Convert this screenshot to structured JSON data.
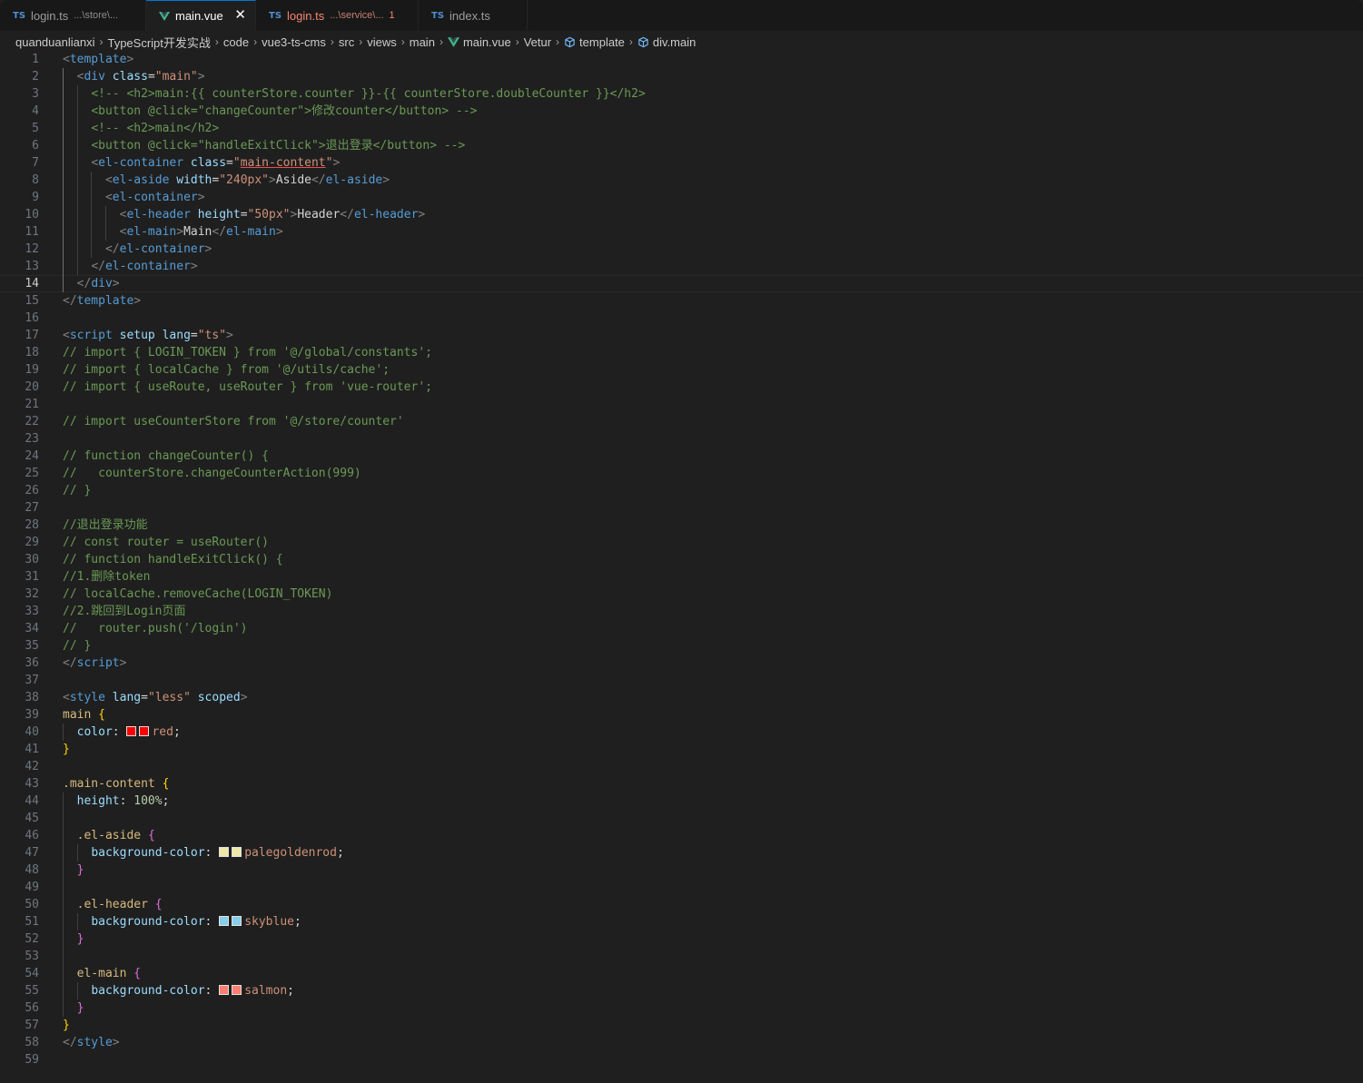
{
  "tabs": [
    {
      "lang": "TS",
      "name": "login.ts",
      "desc": "...\\store\\...",
      "active": false,
      "error": false
    },
    {
      "lang": "V",
      "name": "main.vue",
      "desc": "",
      "active": true,
      "error": false,
      "close": "✕"
    },
    {
      "lang": "TS",
      "name": "login.ts",
      "desc": "...\\service\\...",
      "active": false,
      "error": true,
      "badge": "1"
    },
    {
      "lang": "TS",
      "name": "index.ts",
      "desc": "",
      "active": false,
      "error": false
    }
  ],
  "breadcrumb": [
    "quanduanlianxi",
    "TypeScript开发实战",
    "code",
    "vue3-ts-cms",
    "src",
    "views",
    "main",
    "main.vue",
    "Vetur",
    "template",
    "div.main"
  ],
  "current_line": 14,
  "colors": {
    "accent": "#0078d4",
    "error": "#f48771",
    "swatch_red": "#ff0000",
    "swatch_palegoldenrod": "#eee8aa",
    "swatch_skyblue": "#87ceeb",
    "swatch_salmon": "#fa8072"
  },
  "lines": [
    [
      [
        "k-punct",
        "<"
      ],
      [
        "k-tag",
        "template"
      ],
      [
        "k-punct",
        ">"
      ]
    ],
    [
      [
        "",
        "  "
      ],
      [
        "k-punct",
        "<"
      ],
      [
        "k-tag",
        "div"
      ],
      [
        "k-text",
        " "
      ],
      [
        "k-attr",
        "class"
      ],
      [
        "k-text",
        "="
      ],
      [
        "k-str",
        "\"main\""
      ],
      [
        "k-punct",
        ">"
      ]
    ],
    [
      [
        "",
        "    "
      ],
      [
        "k-com",
        "<!-- <h2>main:{{ counterStore.counter }}-{{ counterStore.doubleCounter }}</h2>"
      ]
    ],
    [
      [
        "",
        "    "
      ],
      [
        "k-com",
        "<button @click=\"changeCounter\">修改counter</button> -->"
      ]
    ],
    [
      [
        "",
        "    "
      ],
      [
        "k-com",
        "<!-- <h2>main</h2>"
      ]
    ],
    [
      [
        "",
        "    "
      ],
      [
        "k-com",
        "<button @click=\"handleExitClick\">退出登录</button> -->"
      ]
    ],
    [
      [
        "",
        "    "
      ],
      [
        "k-punct",
        "<"
      ],
      [
        "k-tag",
        "el-container"
      ],
      [
        "k-text",
        " "
      ],
      [
        "k-attr",
        "class"
      ],
      [
        "k-text",
        "="
      ],
      [
        "k-str",
        "\""
      ],
      [
        "k-str k-und",
        "main-content"
      ],
      [
        "k-str",
        "\""
      ],
      [
        "k-punct",
        ">"
      ]
    ],
    [
      [
        "",
        "      "
      ],
      [
        "k-punct",
        "<"
      ],
      [
        "k-tag",
        "el-aside"
      ],
      [
        "k-text",
        " "
      ],
      [
        "k-attr",
        "width"
      ],
      [
        "k-text",
        "="
      ],
      [
        "k-str",
        "\"240px\""
      ],
      [
        "k-punct",
        ">"
      ],
      [
        "k-text",
        "Aside"
      ],
      [
        "k-punct",
        "</"
      ],
      [
        "k-tag",
        "el-aside"
      ],
      [
        "k-punct",
        ">"
      ]
    ],
    [
      [
        "",
        "      "
      ],
      [
        "k-punct",
        "<"
      ],
      [
        "k-tag",
        "el-container"
      ],
      [
        "k-punct",
        ">"
      ]
    ],
    [
      [
        "",
        "        "
      ],
      [
        "k-punct",
        "<"
      ],
      [
        "k-tag",
        "el-header"
      ],
      [
        "k-text",
        " "
      ],
      [
        "k-attr",
        "height"
      ],
      [
        "k-text",
        "="
      ],
      [
        "k-str",
        "\"50px\""
      ],
      [
        "k-punct",
        ">"
      ],
      [
        "k-text",
        "Header"
      ],
      [
        "k-punct",
        "</"
      ],
      [
        "k-tag",
        "el-header"
      ],
      [
        "k-punct",
        ">"
      ]
    ],
    [
      [
        "",
        "        "
      ],
      [
        "k-punct",
        "<"
      ],
      [
        "k-tag",
        "el-main"
      ],
      [
        "k-punct",
        ">"
      ],
      [
        "k-text",
        "Main"
      ],
      [
        "k-punct",
        "</"
      ],
      [
        "k-tag",
        "el-main"
      ],
      [
        "k-punct",
        ">"
      ]
    ],
    [
      [
        "",
        "      "
      ],
      [
        "k-punct",
        "</"
      ],
      [
        "k-tag",
        "el-container"
      ],
      [
        "k-punct",
        ">"
      ]
    ],
    [
      [
        "",
        "    "
      ],
      [
        "k-punct",
        "</"
      ],
      [
        "k-tag",
        "el-container"
      ],
      [
        "k-punct",
        ">"
      ]
    ],
    [
      [
        "",
        "  "
      ],
      [
        "k-punct",
        "</"
      ],
      [
        "k-tag",
        "div"
      ],
      [
        "k-punct",
        ">"
      ]
    ],
    [
      [
        "k-punct",
        "</"
      ],
      [
        "k-tag",
        "template"
      ],
      [
        "k-punct",
        ">"
      ]
    ],
    [],
    [
      [
        "k-punct",
        "<"
      ],
      [
        "k-tag",
        "script"
      ],
      [
        "k-text",
        " "
      ],
      [
        "k-attr",
        "setup"
      ],
      [
        "k-text",
        " "
      ],
      [
        "k-attr",
        "lang"
      ],
      [
        "k-text",
        "="
      ],
      [
        "k-str",
        "\"ts\""
      ],
      [
        "k-punct",
        ">"
      ]
    ],
    [
      [
        "k-com",
        "// import { LOGIN_TOKEN } from '@/global/constants';"
      ]
    ],
    [
      [
        "k-com",
        "// import { localCache } from '@/utils/cache';"
      ]
    ],
    [
      [
        "k-com",
        "// import { useRoute, useRouter } from 'vue-router';"
      ]
    ],
    [],
    [
      [
        "k-com",
        "// import useCounterStore from '@/store/counter'"
      ]
    ],
    [],
    [
      [
        "k-com",
        "// function changeCounter() {"
      ]
    ],
    [
      [
        "k-com",
        "//   counterStore.changeCounterAction(999)"
      ]
    ],
    [
      [
        "k-com",
        "// }"
      ]
    ],
    [],
    [
      [
        "k-com",
        "//退出登录功能"
      ]
    ],
    [
      [
        "k-com",
        "// const router = useRouter()"
      ]
    ],
    [
      [
        "k-com",
        "// function handleExitClick() {"
      ]
    ],
    [
      [
        "k-com",
        "//1.删除token"
      ]
    ],
    [
      [
        "k-com",
        "// localCache.removeCache(LOGIN_TOKEN)"
      ]
    ],
    [
      [
        "k-com",
        "//2.跳回到Login页面"
      ]
    ],
    [
      [
        "k-com",
        "//   router.push('/login')"
      ]
    ],
    [
      [
        "k-com",
        "// }"
      ]
    ],
    [
      [
        "k-punct",
        "</"
      ],
      [
        "k-tag",
        "script"
      ],
      [
        "k-punct",
        ">"
      ]
    ],
    [],
    [
      [
        "k-punct",
        "<"
      ],
      [
        "k-tag",
        "style"
      ],
      [
        "k-text",
        " "
      ],
      [
        "k-attr",
        "lang"
      ],
      [
        "k-text",
        "="
      ],
      [
        "k-str",
        "\"less\""
      ],
      [
        "k-text",
        " "
      ],
      [
        "k-attr",
        "scoped"
      ],
      [
        "k-punct",
        ">"
      ]
    ],
    [
      [
        "k-sel",
        "main"
      ],
      [
        "k-text",
        " "
      ],
      [
        "k-br1",
        "{"
      ]
    ],
    [
      [
        "",
        "  "
      ],
      [
        "k-prop",
        "color"
      ],
      [
        "k-text",
        ": "
      ],
      [
        "swatch",
        "#ff0000"
      ],
      [
        "swatch",
        "#ff0000"
      ],
      [
        "k-val",
        "red"
      ],
      [
        "k-text",
        ";"
      ]
    ],
    [
      [
        "k-br1",
        "}"
      ]
    ],
    [],
    [
      [
        "k-sel",
        ".main-content"
      ],
      [
        "k-text",
        " "
      ],
      [
        "k-br1",
        "{"
      ]
    ],
    [
      [
        "",
        "  "
      ],
      [
        "k-prop",
        "height"
      ],
      [
        "k-text",
        ": "
      ],
      [
        "k-num",
        "100%"
      ],
      [
        "k-text",
        ";"
      ]
    ],
    [],
    [
      [
        "",
        "  "
      ],
      [
        "k-sel",
        ".el-aside"
      ],
      [
        "k-text",
        " "
      ],
      [
        "k-br2",
        "{"
      ]
    ],
    [
      [
        "",
        "    "
      ],
      [
        "k-prop",
        "background-color"
      ],
      [
        "k-text",
        ": "
      ],
      [
        "swatch",
        "#eee8aa"
      ],
      [
        "swatch",
        "#eee8aa"
      ],
      [
        "k-val",
        "palegoldenrod"
      ],
      [
        "k-text",
        ";"
      ]
    ],
    [
      [
        "",
        "  "
      ],
      [
        "k-br2",
        "}"
      ]
    ],
    [],
    [
      [
        "",
        "  "
      ],
      [
        "k-sel",
        ".el-header"
      ],
      [
        "k-text",
        " "
      ],
      [
        "k-br2",
        "{"
      ]
    ],
    [
      [
        "",
        "    "
      ],
      [
        "k-prop",
        "background-color"
      ],
      [
        "k-text",
        ": "
      ],
      [
        "swatch",
        "#87ceeb"
      ],
      [
        "swatch",
        "#87ceeb"
      ],
      [
        "k-val",
        "skyblue"
      ],
      [
        "k-text",
        ";"
      ]
    ],
    [
      [
        "",
        "  "
      ],
      [
        "k-br2",
        "}"
      ]
    ],
    [],
    [
      [
        "",
        "  "
      ],
      [
        "k-sel",
        "el-main"
      ],
      [
        "k-text",
        " "
      ],
      [
        "k-br2",
        "{"
      ]
    ],
    [
      [
        "",
        "    "
      ],
      [
        "k-prop",
        "background-color"
      ],
      [
        "k-text",
        ": "
      ],
      [
        "swatch",
        "#fa8072"
      ],
      [
        "swatch",
        "#fa8072"
      ],
      [
        "k-val",
        "salmon"
      ],
      [
        "k-text",
        ";"
      ]
    ],
    [
      [
        "",
        "  "
      ],
      [
        "k-br2",
        "}"
      ]
    ],
    [
      [
        "k-br1",
        "}"
      ]
    ],
    [
      [
        "k-punct",
        "</"
      ],
      [
        "k-tag",
        "style"
      ],
      [
        "k-punct",
        ">"
      ]
    ],
    []
  ]
}
